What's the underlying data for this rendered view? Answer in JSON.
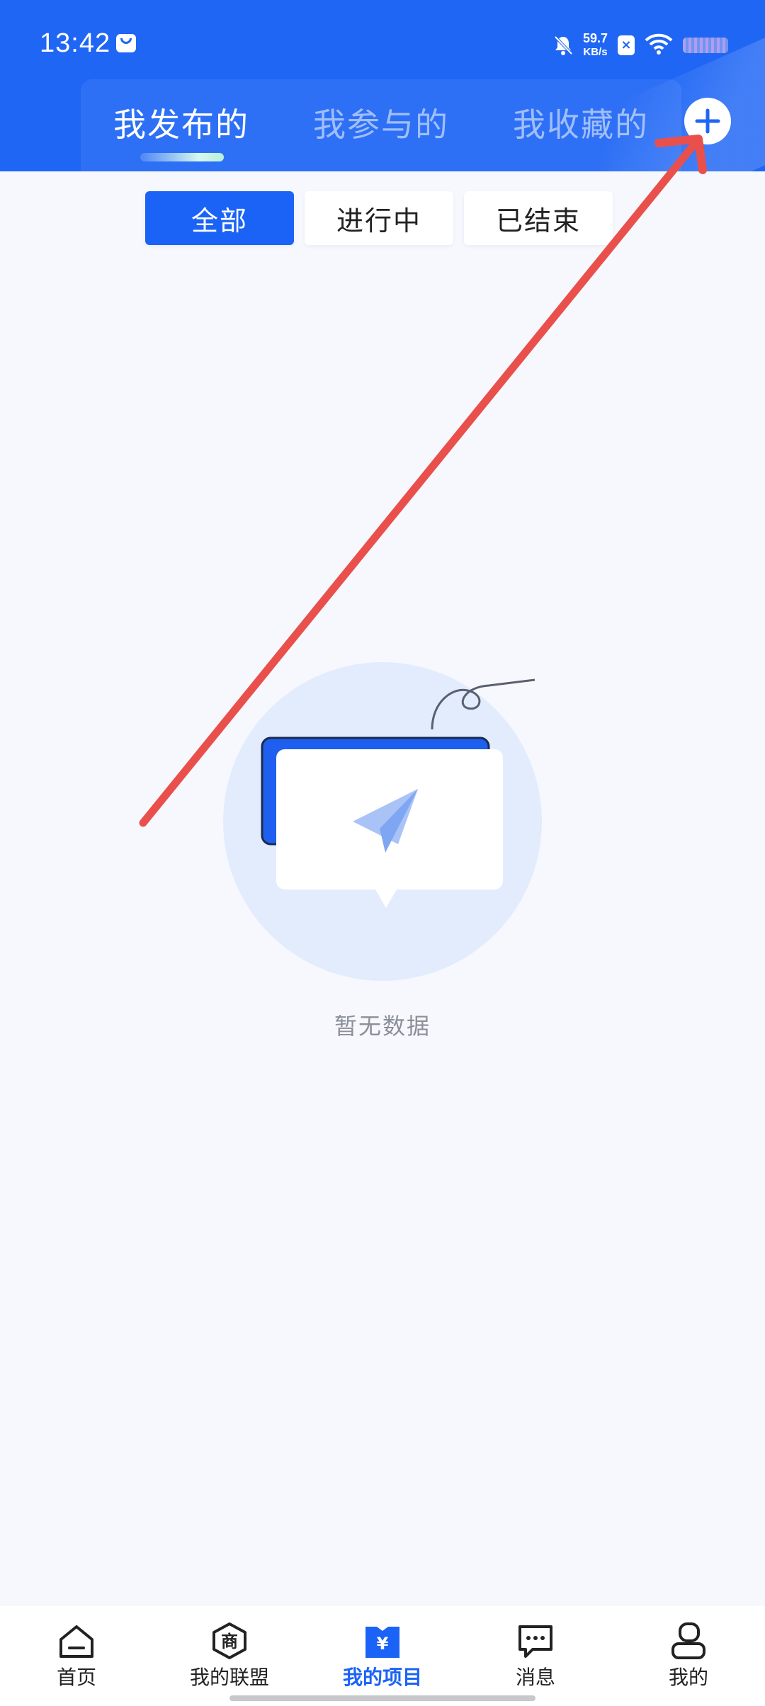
{
  "status_bar": {
    "time": "13:42",
    "net_speed_value": "59.7",
    "net_speed_unit": "KB/s",
    "icons": [
      "message-icon",
      "bell-off-icon",
      "sim-x-icon",
      "wifi-icon",
      "battery-icon"
    ]
  },
  "header": {
    "tabs": [
      {
        "label": "我发布的",
        "active": true
      },
      {
        "label": "我参与的",
        "active": false
      },
      {
        "label": "我收藏的",
        "active": false
      }
    ],
    "add_icon": "plus-icon"
  },
  "filters": [
    {
      "label": "全部",
      "active": true
    },
    {
      "label": "进行中",
      "active": false
    },
    {
      "label": "已结束",
      "active": false
    }
  ],
  "empty_state": {
    "message": "暂无数据",
    "illustration": "paper-plane-icon"
  },
  "bottom_nav": [
    {
      "label": "首页",
      "icon": "home-icon",
      "active": false
    },
    {
      "label": "我的联盟",
      "icon": "shop-icon",
      "active": false
    },
    {
      "label": "我的项目",
      "icon": "project-icon",
      "active": true
    },
    {
      "label": "消息",
      "icon": "chat-icon",
      "active": false
    },
    {
      "label": "我的",
      "icon": "user-icon",
      "active": false
    }
  ],
  "colors": {
    "primary": "#1f66f5",
    "annotation_arrow": "#e9504c",
    "background": "#f6f8fd"
  }
}
